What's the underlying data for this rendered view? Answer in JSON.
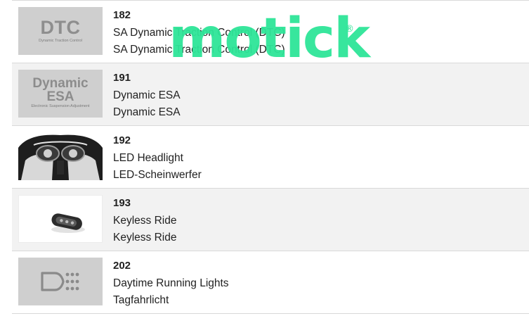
{
  "items": [
    {
      "code": "182",
      "name_en": "SA Dynamic Traction Control (DTC)",
      "name_de": "SA Dynamic Traction Control (DTC)",
      "thumb_title": "DTC",
      "thumb_subtitle": "Dynamic Traction Control"
    },
    {
      "code": "191",
      "name_en": "Dynamic ESA",
      "name_de": "Dynamic ESA",
      "thumb_title_1": "Dynamic",
      "thumb_title_2": "ESA",
      "thumb_subtitle": "Electronic Suspension Adjustment"
    },
    {
      "code": "192",
      "name_en": "LED Headlight",
      "name_de": "LED-Scheinwerfer",
      "thumb_icon": "led-headlight-photo"
    },
    {
      "code": "193",
      "name_en": "Keyless Ride",
      "name_de": "Keyless Ride",
      "thumb_icon": "key-fob-photo"
    },
    {
      "code": "202",
      "name_en": "Daytime Running Lights",
      "name_de": "Tagfahrlicht",
      "thumb_icon": "daytime-running-lights-icon"
    }
  ],
  "watermark": {
    "text": "motick",
    "mark": "®",
    "color": "#2ee598"
  }
}
